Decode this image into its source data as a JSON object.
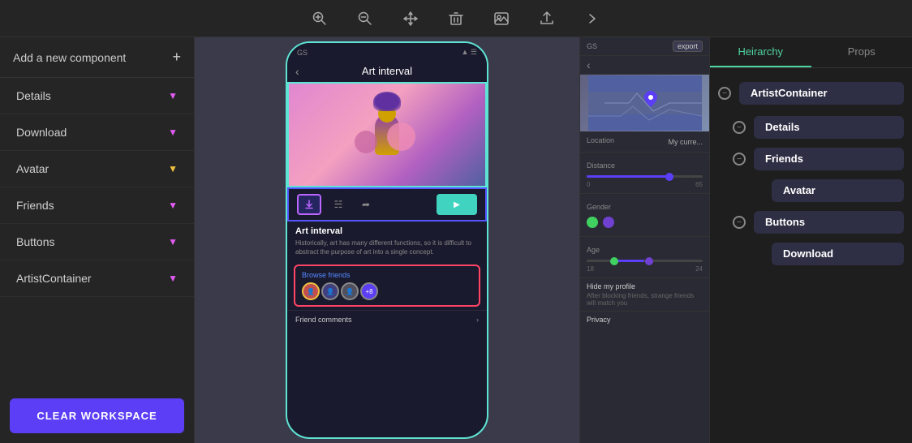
{
  "toolbar": {
    "icons": [
      "zoom-in",
      "zoom-out",
      "move",
      "delete",
      "image",
      "download",
      "forward"
    ]
  },
  "sidebar": {
    "header_label": "Add a new component",
    "header_plus": "+",
    "items": [
      {
        "id": "details",
        "label": "Details",
        "chevron_color": "pink"
      },
      {
        "id": "download",
        "label": "Download",
        "chevron_color": "pink"
      },
      {
        "id": "avatar",
        "label": "Avatar",
        "chevron_color": "yellow"
      },
      {
        "id": "friends",
        "label": "Friends",
        "chevron_color": "pink"
      },
      {
        "id": "buttons",
        "label": "Buttons",
        "chevron_color": "pink"
      },
      {
        "id": "artist-container",
        "label": "ArtistContainer",
        "chevron_color": "pink"
      }
    ],
    "clear_btn_label": "CLEAR WORKSPACE"
  },
  "canvas": {
    "phone": {
      "status_bar_left": "GS",
      "status_bar_icons": "▲ ☰",
      "back_arrow": "‹",
      "title": "Art interval",
      "art_title": "Art interval",
      "art_desc": "Historically, art has many different functions, so it is difficult to abstract the purpose of art into a single concept.",
      "friends_label": "Browse friends",
      "friends_count": "+8",
      "comments_label": "Friend comments",
      "comments_arrow": "›"
    }
  },
  "filter_panel": {
    "gs_label": "GS",
    "export_label": "export",
    "back_arrow": "‹",
    "location_label": "Location",
    "location_value": "My curre...",
    "distance_label": "Distance",
    "distance_min": "0",
    "distance_max": "65",
    "gender_label": "Gender",
    "age_label": "Age",
    "age_min": "18",
    "age_max": "24",
    "hide_profile_label": "Hide my profile",
    "hide_profile_sub": "After blocking friends, strange friends will match you",
    "privacy_label": "Privacy"
  },
  "hierarchy": {
    "tab_hierarchy": "Heirarchy",
    "tab_props": "Props",
    "items": [
      {
        "id": "artist-container",
        "label": "ArtistContainer",
        "level": 0,
        "has_minus": true
      },
      {
        "id": "details",
        "label": "Details",
        "level": 1,
        "has_minus": true
      },
      {
        "id": "friends",
        "label": "Friends",
        "level": 1,
        "has_minus": true
      },
      {
        "id": "avatar",
        "label": "Avatar",
        "level": 2,
        "has_minus": false
      },
      {
        "id": "buttons",
        "label": "Buttons",
        "level": 1,
        "has_minus": true
      },
      {
        "id": "download",
        "label": "Download",
        "level": 2,
        "has_minus": false
      }
    ]
  }
}
